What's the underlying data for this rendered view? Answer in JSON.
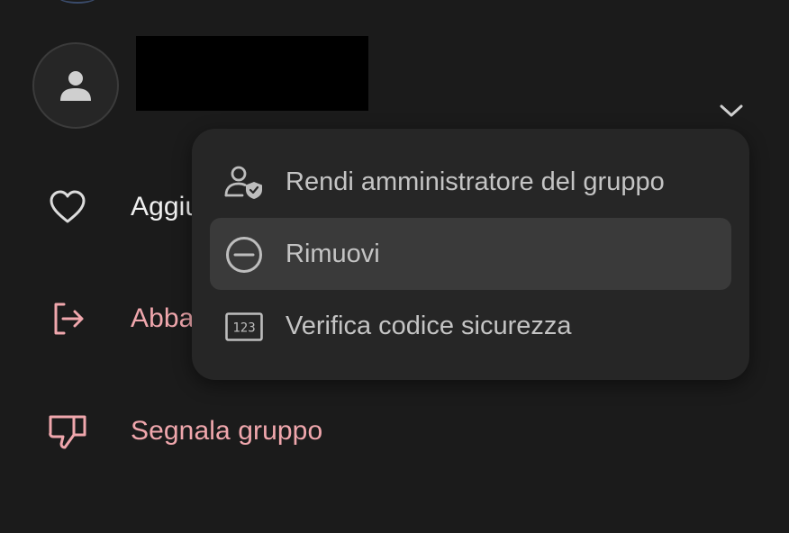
{
  "contact": {
    "name": ""
  },
  "actions": {
    "add_label": "Aggiu",
    "leave_label": "Abba",
    "report_label": "Segnala gruppo"
  },
  "menu": {
    "items": [
      {
        "label": "Rendi amministratore del gruppo",
        "icon": "admin-shield-person-icon"
      },
      {
        "label": "Rimuovi",
        "icon": "remove-circle-icon",
        "highlighted": true
      },
      {
        "label": "Verifica codice sicurezza",
        "icon": "safety-number-123-icon"
      }
    ]
  },
  "colors": {
    "background": "#1b1b1b",
    "menu_background": "#262626",
    "menu_highlight": "#3a3a3a",
    "text_primary": "#f0f0f0",
    "text_menu": "#c4c4c4",
    "danger": "#f0a7ad"
  }
}
